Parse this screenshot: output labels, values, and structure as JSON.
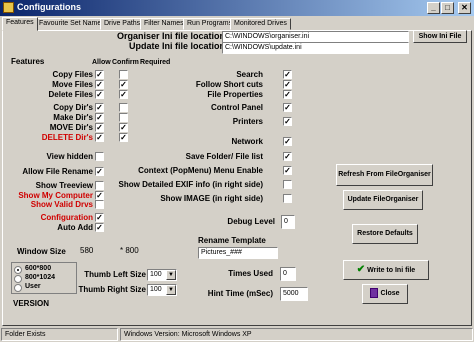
{
  "window": {
    "title": "Configurations",
    "minimize": "_",
    "maximize": "□",
    "close": "✕"
  },
  "tabs": [
    "Features",
    "Favourite Set Names",
    "Drive Paths",
    "Filter Names",
    "Run Programs",
    "Monitored Drives"
  ],
  "header": {
    "organiser_label": "Organiser Ini file location",
    "organiser_value": "C:\\WINDOWS\\organiser.ini",
    "update_label": "Update Ini file location",
    "update_value": "C:\\WINDOWS\\update.ini",
    "show_ini_button": "Show Ini File"
  },
  "features": {
    "heading": "Features",
    "col_allow": "Allow",
    "col_confirm": "Confirm",
    "col_required": "Required",
    "check_mark": "✓",
    "left_items": [
      {
        "label": "Copy Files",
        "allow": true,
        "confirm": false
      },
      {
        "label": "Move Files",
        "allow": true,
        "confirm": true
      },
      {
        "label": "Delete Files",
        "allow": true,
        "confirm": true
      },
      {
        "label": "Copy Dir's",
        "allow": true,
        "confirm": false
      },
      {
        "label": "Make Dir's",
        "allow": true,
        "confirm": false
      },
      {
        "label": "MOVE Dir's",
        "allow": true,
        "confirm": true
      },
      {
        "label": "DELETE Dir's",
        "allow": true,
        "confirm": true
      },
      {
        "label": "View hidden",
        "allow": false
      },
      {
        "label": "Allow File Rename",
        "allow": true
      },
      {
        "label": "Show Treeview",
        "allow": false
      },
      {
        "label": "Show My Computer",
        "allow": true
      },
      {
        "label": "Show Valid Drvs",
        "allow": false
      },
      {
        "label": "Configuration",
        "allow": true
      },
      {
        "label": "Auto Add",
        "allow": true
      }
    ],
    "right_items": [
      {
        "label": "Search",
        "checked": true
      },
      {
        "label": "Follow Short cuts",
        "checked": true
      },
      {
        "label": "File Properties",
        "checked": true
      },
      {
        "label": "Control Panel",
        "checked": true
      },
      {
        "label": "Printers",
        "checked": true
      },
      {
        "label": "Network",
        "checked": true
      },
      {
        "label": "Save Folder/ File list",
        "checked": true
      },
      {
        "label": "Context (PopMenu) Menu Enable",
        "checked": true
      },
      {
        "label": "Show Detailed EXIF info (in right side)",
        "checked": false
      },
      {
        "label": "Show IMAGE (in right side)",
        "checked": false
      }
    ]
  },
  "window_size": {
    "label": "Window Size",
    "width": "580",
    "height": "* 800",
    "options": [
      "600*800",
      "800*1024",
      "User"
    ],
    "selected_index": 0,
    "version_label": "VERSION"
  },
  "thumbs": {
    "left_label": "Thumb Left Size",
    "left_value": "100",
    "right_label": "Thumb Right Size",
    "right_value": "100"
  },
  "debug": {
    "label": "Debug Level",
    "value": "0"
  },
  "rename": {
    "label": "Rename Template",
    "value": "Pictures_###"
  },
  "times_used": {
    "label": "Times Used",
    "value": "0"
  },
  "hint_time": {
    "label": "Hint Time (mSec)",
    "value": "5000"
  },
  "buttons": {
    "refresh": "Refresh From FileOrganiser",
    "update": "Update FileOrganiser",
    "restore": "Restore Defaults",
    "write": "Write to Ini file",
    "close": "Close"
  },
  "status": {
    "left": "Folder Exists",
    "right": "Windows Version: Microsoft Windows XP"
  },
  "colors": {
    "red_label": "#d00000",
    "title_bar": "#0a246a"
  }
}
